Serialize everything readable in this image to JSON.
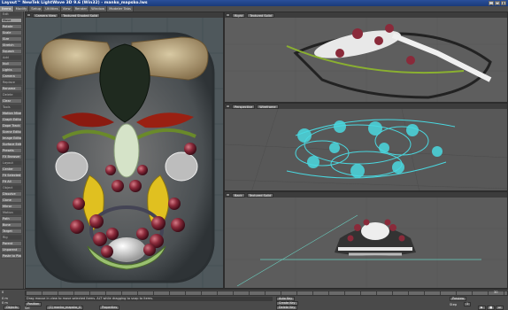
{
  "app": {
    "title": "Layout™ NewTek LightWave 3D 9.6 (Win32) - manko_mapsko.lws"
  },
  "menubar": [
    "Items",
    "Modify",
    "Setup",
    "Utilities",
    "View",
    "Render",
    "Window",
    "Modeler Tabs"
  ],
  "sidebar": {
    "items": [
      {
        "label": "Edit",
        "hdr": true
      },
      {
        "label": "Move",
        "sel": true
      },
      {
        "label": "Rotate"
      },
      {
        "label": "Scale"
      },
      {
        "label": "Size"
      },
      {
        "label": "Stretch"
      },
      {
        "label": "Squash"
      },
      {
        "label": "Add",
        "hdr": true
      },
      {
        "label": "Null"
      },
      {
        "label": "Lights"
      },
      {
        "label": "Camera"
      },
      {
        "label": "Replace",
        "hdr": true
      },
      {
        "label": "Rename"
      },
      {
        "label": "Delete",
        "hdr": true
      },
      {
        "label": "Clear"
      },
      {
        "label": "Tools",
        "hdr": true
      },
      {
        "label": "Motion Mixer"
      },
      {
        "label": "Graph Editor"
      },
      {
        "label": "Dope Track"
      },
      {
        "label": "Scene Editor"
      },
      {
        "label": "Image Editor"
      },
      {
        "label": "Surface Editor"
      },
      {
        "label": "Presets"
      },
      {
        "label": "FX Browser"
      },
      {
        "label": "Layout",
        "hdr": true
      },
      {
        "label": "Center"
      },
      {
        "label": "Fit Selected"
      },
      {
        "label": "Fit All"
      },
      {
        "label": "Object",
        "hdr": true
      },
      {
        "label": "Dissolve"
      },
      {
        "label": "Clone"
      },
      {
        "label": "Mirror"
      },
      {
        "label": "Motion",
        "hdr": true
      },
      {
        "label": "Path"
      },
      {
        "label": "Bone"
      },
      {
        "label": "Target"
      },
      {
        "label": "Rig",
        "hdr": true
      },
      {
        "label": "Parent"
      },
      {
        "label": "Unparent"
      },
      {
        "label": "Paste to Place"
      }
    ]
  },
  "viewports": {
    "front": {
      "label": "Camera View",
      "mode": "Textured Shaded Solid"
    },
    "top": {
      "label": "Right",
      "mode": "Textured Solid"
    },
    "persp": {
      "label": "Perspective",
      "mode": "Wireframe"
    },
    "back": {
      "label": "Back",
      "mode": "Textured Solid"
    }
  },
  "bottom": {
    "frame_start": "0",
    "frame_end": "1.00",
    "status": "Drag mouse in view to move selected items. ALT while dragging to snap to items.",
    "position_label": "Position",
    "item_type": "Objects",
    "current_item": "(1) manko_mapsko_4",
    "properties": "Properties",
    "sel_label": "Sel",
    "auto_key": "Auto Key",
    "create_key": "Create Key",
    "delete_key": "Delete Key",
    "preview": "Preview",
    "step_label": "Step",
    "step_val": "1",
    "x_val": "0 m",
    "y_val": "0 m",
    "end_frame": "30"
  }
}
